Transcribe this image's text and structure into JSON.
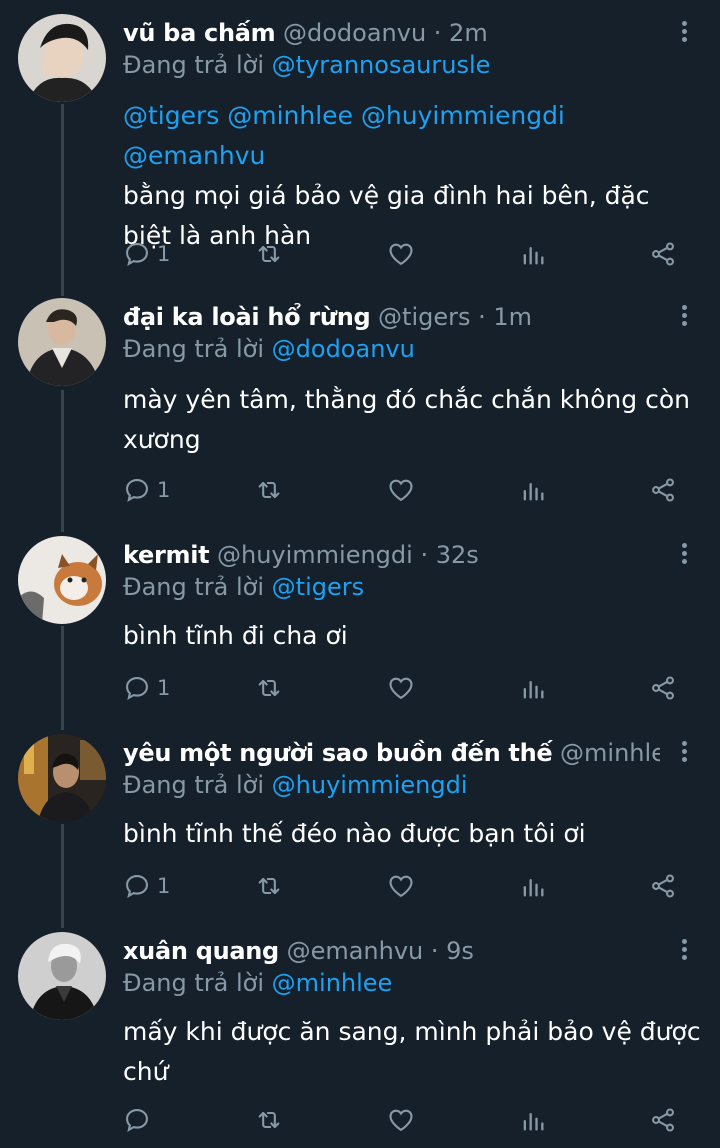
{
  "colors": {
    "background": "#15202b",
    "text": "#ffffff",
    "muted": "#8899a6",
    "link": "#1da1f2",
    "thread_line": "#38444d"
  },
  "reply_prefix": "Đang trả lời",
  "tweets": [
    {
      "name": "vũ ba chấm",
      "handle": "@dodoanvu",
      "time": "· 2m",
      "replying_to": "@tyrannosaurusle",
      "mentions": "@tigers @minhlee @huyimmiengdi @emanhvu",
      "text": "bằng mọi giá bảo vệ gia đình hai bên, đặc biệt là anh hàn",
      "reply_count": "1"
    },
    {
      "name": "đại ka loài hổ rừng",
      "handle": "@tigers",
      "time": "· 1m",
      "replying_to": "@dodoanvu",
      "text": "mày yên tâm, thằng đó chắc chắn không còn xương",
      "reply_count": "1"
    },
    {
      "name": "kermit",
      "handle": "@huyimmiengdi",
      "time": "· 32s",
      "replying_to": "@tigers",
      "text": "bình tĩnh đi cha ơi",
      "reply_count": "1"
    },
    {
      "name": "yêu một người sao buồn đến thế",
      "handle": "@minhlee ·...",
      "time": "",
      "replying_to": "@huyimmiengdi",
      "text": "bình tĩnh thế đéo nào được bạn tôi ơi",
      "reply_count": "1"
    },
    {
      "name": "xuân quang",
      "handle": "@emanhvu",
      "time": "· 9s",
      "replying_to": "@minhlee",
      "text": "mấy khi được ăn sang, mình phải bảo vệ được chứ",
      "reply_count": ""
    }
  ],
  "icons": [
    "reply-icon",
    "retweet-icon",
    "like-icon",
    "analytics-icon",
    "share-icon",
    "more-icon"
  ]
}
